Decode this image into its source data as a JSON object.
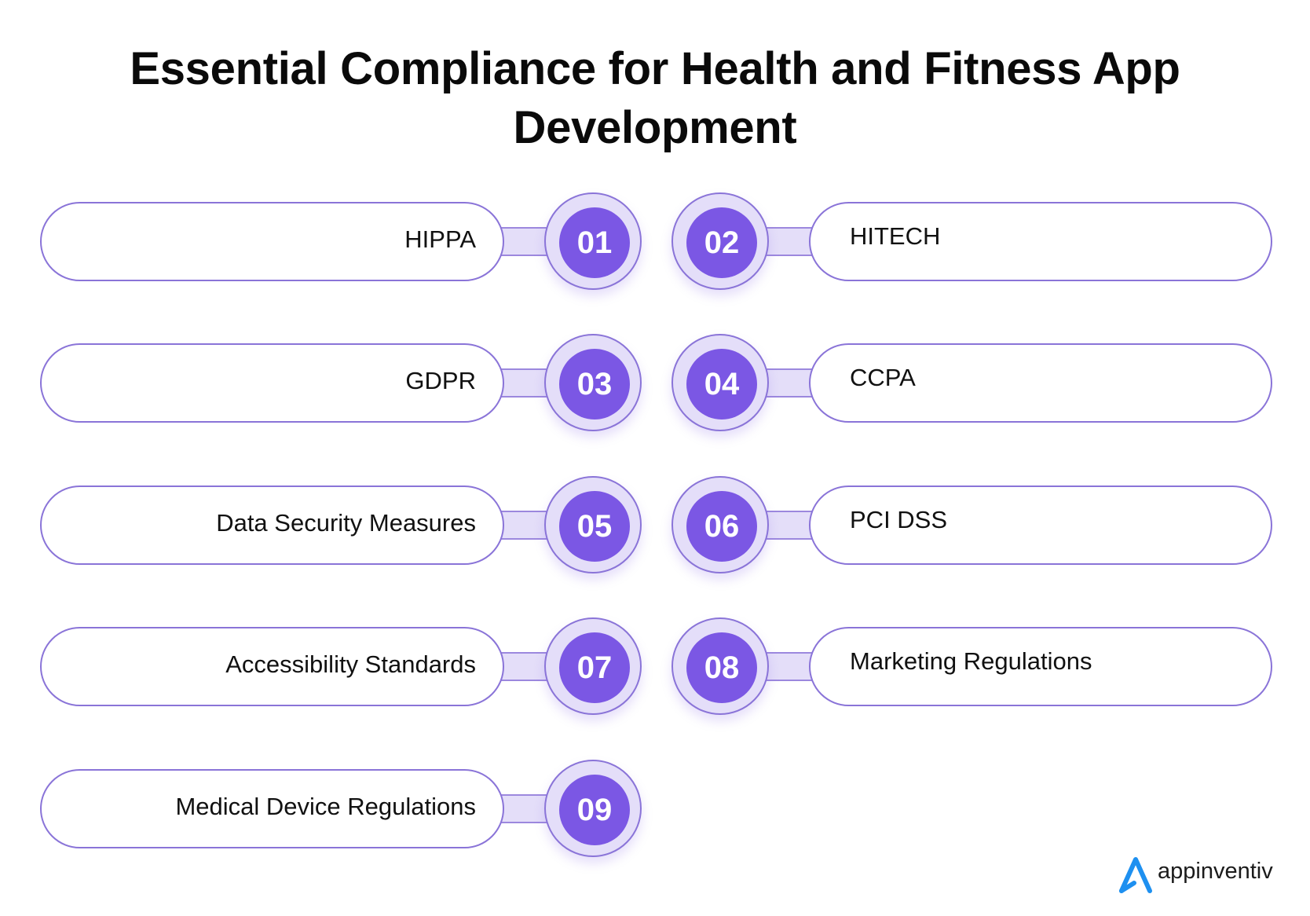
{
  "title": {
    "line1": "Essential Compliance for Health and Fitness App",
    "line2": "Development"
  },
  "items": [
    {
      "number": "01",
      "label": "HIPPA",
      "side": "left"
    },
    {
      "number": "02",
      "label": "HITECH",
      "side": "right"
    },
    {
      "number": "03",
      "label": "GDPR",
      "side": "left"
    },
    {
      "number": "04",
      "label": "CCPA",
      "side": "right"
    },
    {
      "number": "05",
      "label": "Data Security Measures",
      "side": "left"
    },
    {
      "number": "06",
      "label": "PCI DSS",
      "side": "right"
    },
    {
      "number": "07",
      "label": "Accessibility Standards",
      "side": "left"
    },
    {
      "number": "08",
      "label": "Marketing Regulations",
      "side": "right"
    },
    {
      "number": "09",
      "label": "Medical Device Regulations",
      "side": "left"
    }
  ],
  "logo": {
    "text": "appinventiv",
    "icon": "appinventiv-a-logo-icon",
    "icon_color": "#1E90F0"
  },
  "colors": {
    "accent": "#7B57E4",
    "ring_fill": "#E4DEF9",
    "outline": "#8A74D8"
  }
}
